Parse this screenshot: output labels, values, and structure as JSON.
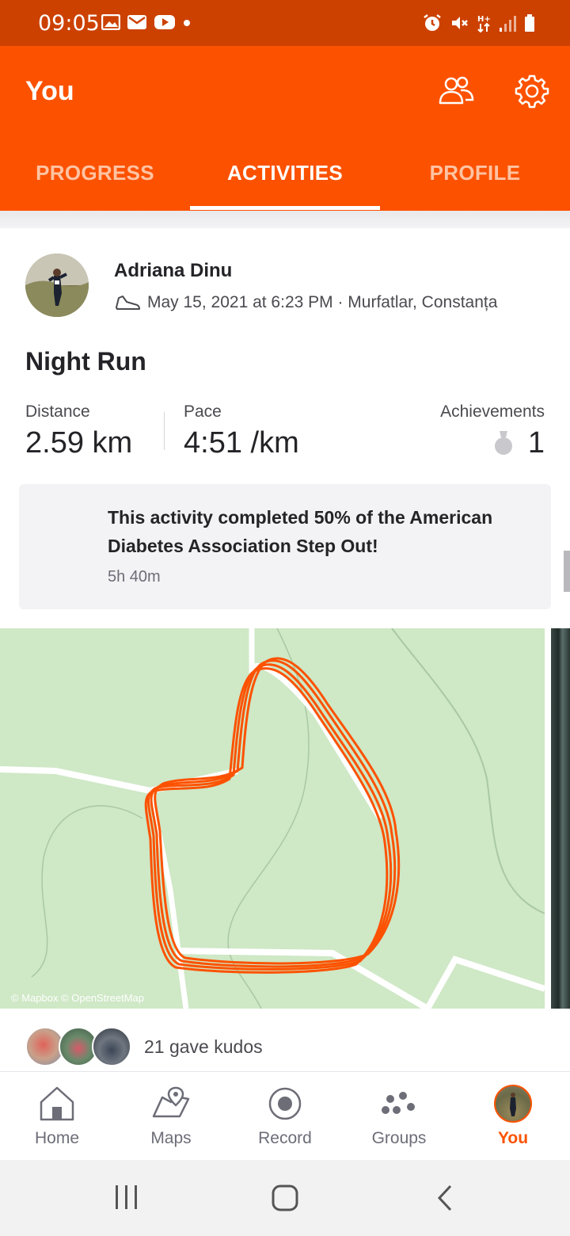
{
  "status_bar": {
    "time": "09:05",
    "left_icons": [
      "image-icon",
      "mail-icon",
      "youtube-icon",
      "dot-icon"
    ],
    "right_icons": [
      "alarm-icon",
      "mute-icon",
      "data-icon",
      "signal-icon",
      "battery-icon"
    ]
  },
  "header": {
    "title": "You",
    "tabs": [
      {
        "label": "PROGRESS",
        "active": false
      },
      {
        "label": "ACTIVITIES",
        "active": true
      },
      {
        "label": "PROFILE",
        "active": false
      }
    ],
    "colors": {
      "brand": "#fc5200",
      "status_bar": "#cc4100"
    }
  },
  "activity": {
    "athlete_name": "Adriana Dinu",
    "meta": "May 15, 2021 at 6:23 PM · Murfatlar, Constanța",
    "title": "Night Run",
    "stats": {
      "distance_label": "Distance",
      "distance_value": "2.59 km",
      "pace_label": "Pace",
      "pace_value": "4:51 /km",
      "achievements_label": "Achievements",
      "achievements_value": "1"
    },
    "challenge": {
      "message": "This activity completed 50% of the American Diabetes Association Step Out!",
      "duration": "5h 40m"
    },
    "map_credit": "© Mapbox © OpenStreetMap",
    "kudos": "21 gave kudos"
  },
  "bottom_nav": [
    {
      "label": "Home",
      "icon": "home-icon",
      "active": false
    },
    {
      "label": "Maps",
      "icon": "maps-icon",
      "active": false
    },
    {
      "label": "Record",
      "icon": "record-icon",
      "active": false
    },
    {
      "label": "Groups",
      "icon": "groups-icon",
      "active": false
    },
    {
      "label": "You",
      "icon": "avatar",
      "active": true
    }
  ],
  "system_nav": [
    "recents-icon",
    "home-system-icon",
    "back-icon"
  ]
}
